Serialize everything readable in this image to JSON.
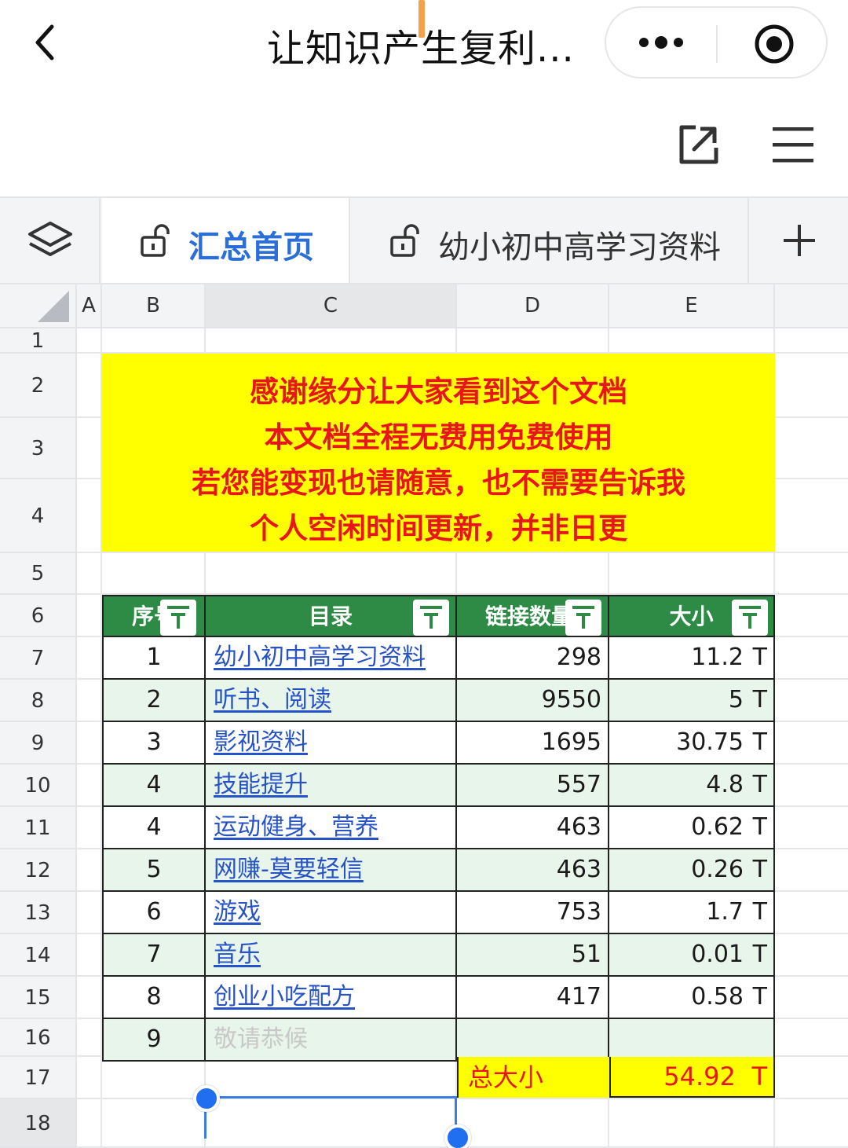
{
  "titlebar": {
    "title": "让知识产生复利..."
  },
  "tabs": [
    {
      "label": "汇总首页",
      "active": true
    },
    {
      "label": "幼小初中高学习资料",
      "active": false
    }
  ],
  "columns": [
    "A",
    "B",
    "C",
    "D",
    "E"
  ],
  "rows": [
    "1",
    "2",
    "3",
    "4",
    "5",
    "6",
    "7",
    "8",
    "9",
    "10",
    "11",
    "12",
    "13",
    "14",
    "15",
    "16",
    "17",
    "18"
  ],
  "banner": {
    "lines": [
      "感谢缘分让大家看到这个文档",
      "本文档全程无费用免费使用",
      "若您能变现也请随意，也不需要告诉我",
      "个人空闲时间更新，并非日更"
    ]
  },
  "table": {
    "headers": {
      "seq": "序号",
      "name": "目录",
      "links": "链接数量",
      "size": "大小"
    },
    "rows": [
      {
        "seq": "1",
        "name": "幼小初中高学习资料",
        "links": "298",
        "size": "11.2",
        "unit": "T"
      },
      {
        "seq": "2",
        "name": "听书、阅读",
        "links": "9550",
        "size": "5",
        "unit": "T"
      },
      {
        "seq": "3",
        "name": "影视资料",
        "links": "1695",
        "size": "30.75",
        "unit": "T"
      },
      {
        "seq": "4",
        "name": "技能提升",
        "links": "557",
        "size": "4.8",
        "unit": "T"
      },
      {
        "seq": "4",
        "name": "运动健身、营养",
        "links": "463",
        "size": "0.62",
        "unit": "T"
      },
      {
        "seq": "5",
        "name": "网赚-莫要轻信",
        "links": "463",
        "size": "0.26",
        "unit": "T"
      },
      {
        "seq": "6",
        "name": "游戏",
        "links": "753",
        "size": "1.7",
        "unit": "T"
      },
      {
        "seq": "7",
        "name": "音乐",
        "links": "51",
        "size": "0.01",
        "unit": "T"
      },
      {
        "seq": "8",
        "name": "创业小吃配方",
        "links": "417",
        "size": "0.58",
        "unit": "T"
      },
      {
        "seq": "9",
        "name": "敬请恭候",
        "links": "",
        "size": "",
        "unit": ""
      }
    ],
    "total": {
      "label": "总大小",
      "value": "54.92",
      "unit": "T"
    }
  },
  "colors": {
    "accent": "#2a6fd8",
    "header_green": "#2e8b46",
    "banner_yellow": "#ffff00",
    "banner_red": "#e8161a",
    "link_blue": "#2653c7",
    "row_alt": "#e8f5ea"
  }
}
